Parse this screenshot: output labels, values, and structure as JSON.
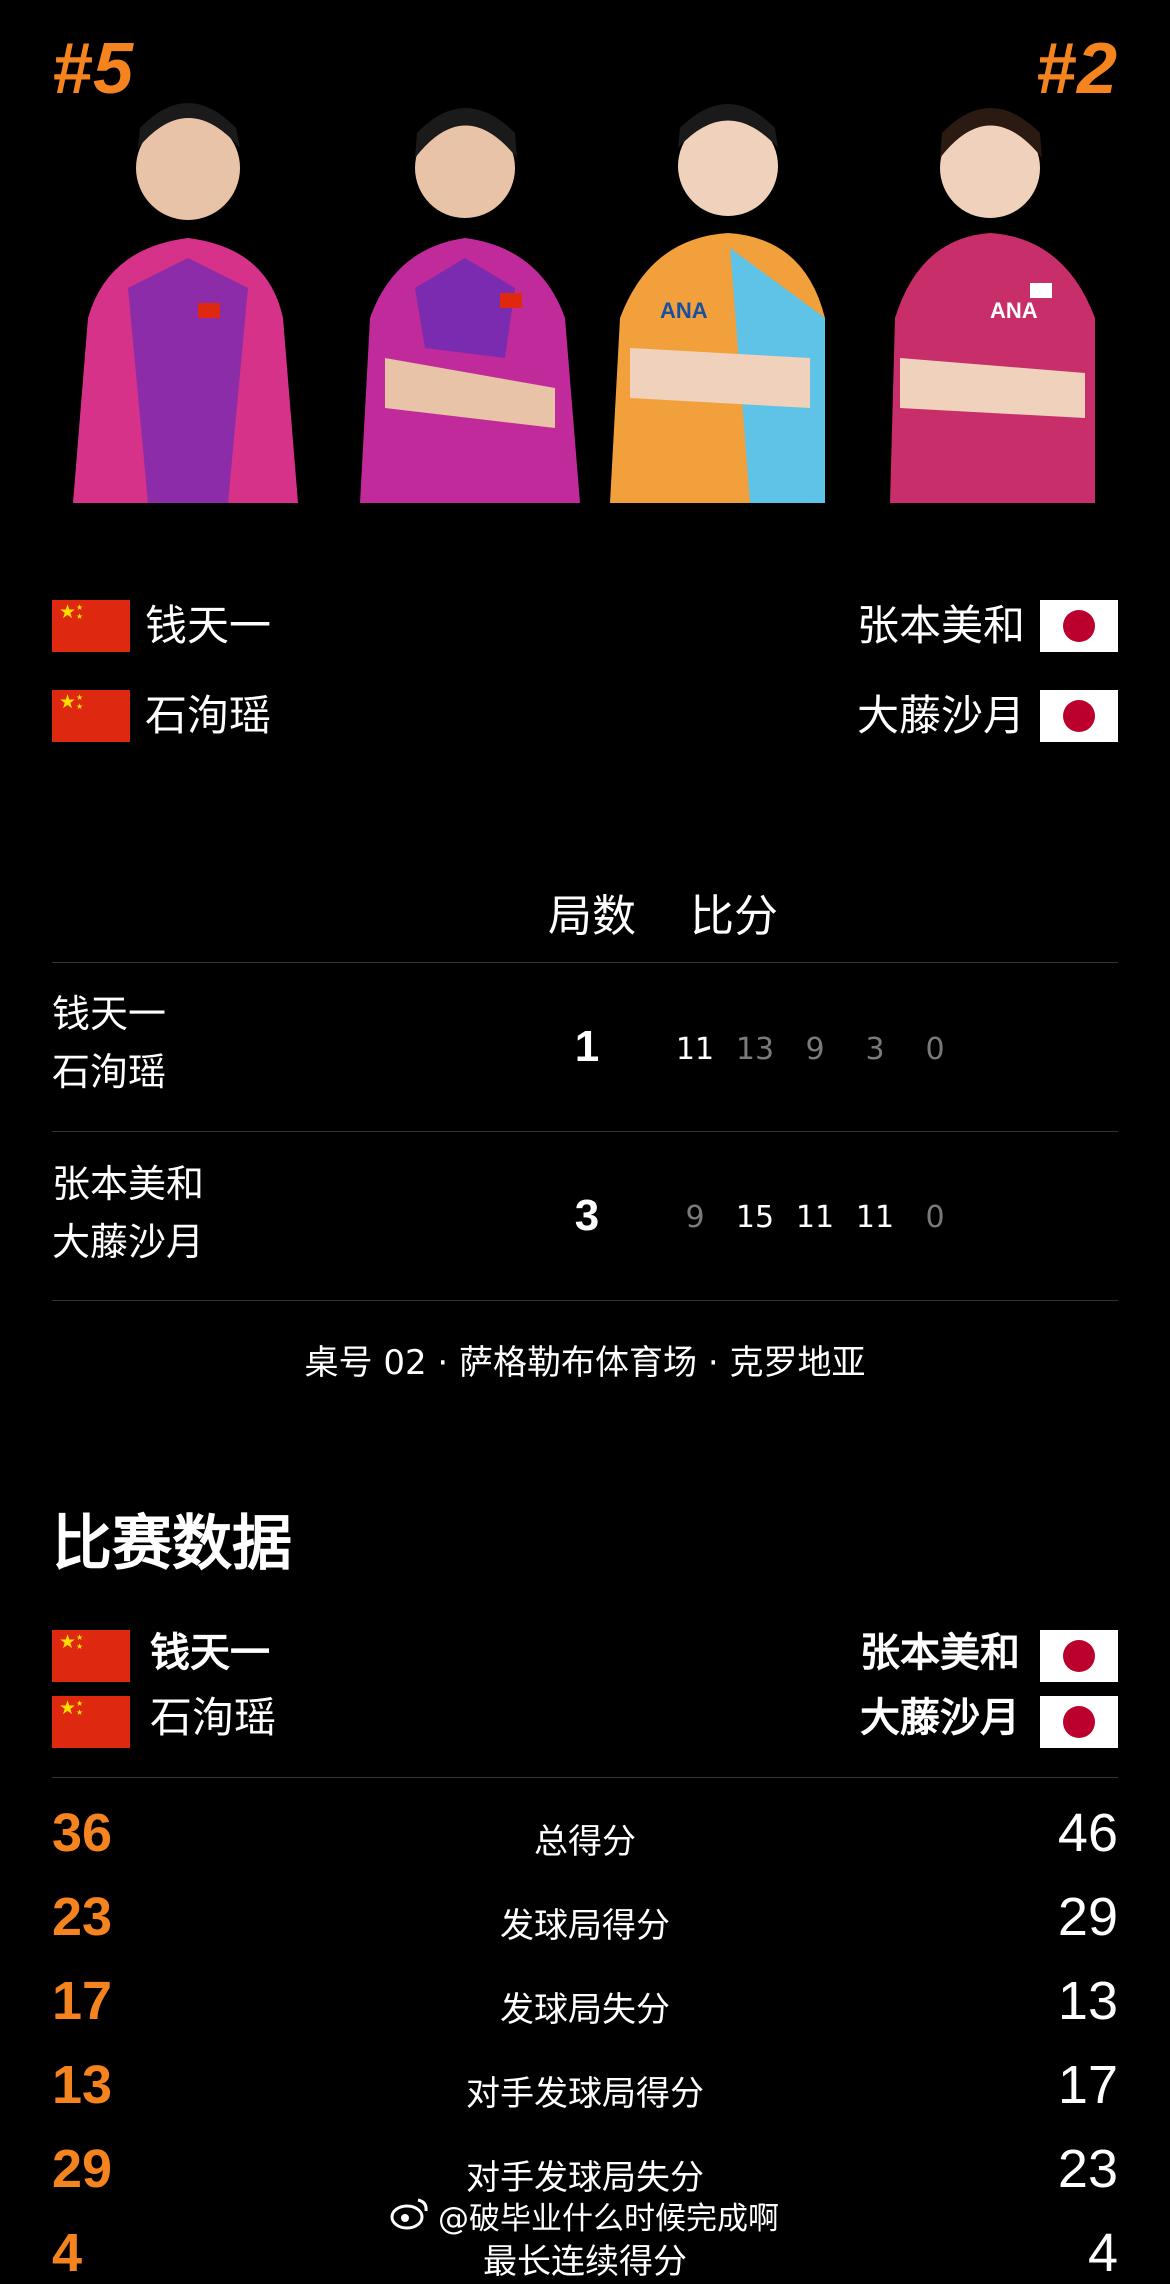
{
  "ranks": {
    "left": "#5",
    "right": "#2"
  },
  "colors": {
    "accent": "#f5841f",
    "background": "#000000",
    "dim": "#7a7a7a"
  },
  "players": {
    "team_a": [
      {
        "name": "钱天一",
        "flag": "china-flag-icon"
      },
      {
        "name": "石洵瑶",
        "flag": "china-flag-icon"
      }
    ],
    "team_b": [
      {
        "name": "张本美和",
        "flag": "japan-flag-icon"
      },
      {
        "name": "大藤沙月",
        "flag": "japan-flag-icon"
      }
    ]
  },
  "scoreboard": {
    "header_sets": "局数",
    "header_score": "比分",
    "rows": [
      {
        "line1": "钱天一",
        "line2": "石洵瑶",
        "sets_won": "1",
        "games": [
          "11",
          "13",
          "9",
          "3",
          "0"
        ],
        "won": [
          true,
          false,
          false,
          false,
          false
        ]
      },
      {
        "line1": "张本美和",
        "line2": "大藤沙月",
        "sets_won": "3",
        "games": [
          "9",
          "15",
          "11",
          "11",
          "0"
        ],
        "won": [
          false,
          true,
          true,
          true,
          false
        ]
      }
    ]
  },
  "venue": "桌号 02 · 萨格勒布体育场 · 克罗地亚",
  "stats": {
    "title": "比赛数据",
    "team_a": [
      "钱天一",
      "石洵瑶"
    ],
    "team_b": [
      "张本美和",
      "大藤沙月"
    ],
    "rows": [
      {
        "label": "总得分",
        "left": "36",
        "right": "46"
      },
      {
        "label": "发球局得分",
        "left": "23",
        "right": "29"
      },
      {
        "label": "发球局失分",
        "left": "17",
        "right": "13"
      },
      {
        "label": "对手发球局得分",
        "left": "13",
        "right": "17"
      },
      {
        "label": "对手发球局失分",
        "left": "29",
        "right": "23"
      },
      {
        "label": "最长连续得分",
        "left": "4",
        "right": "4"
      }
    ]
  },
  "watermark": "@破毕业什么时候完成啊"
}
